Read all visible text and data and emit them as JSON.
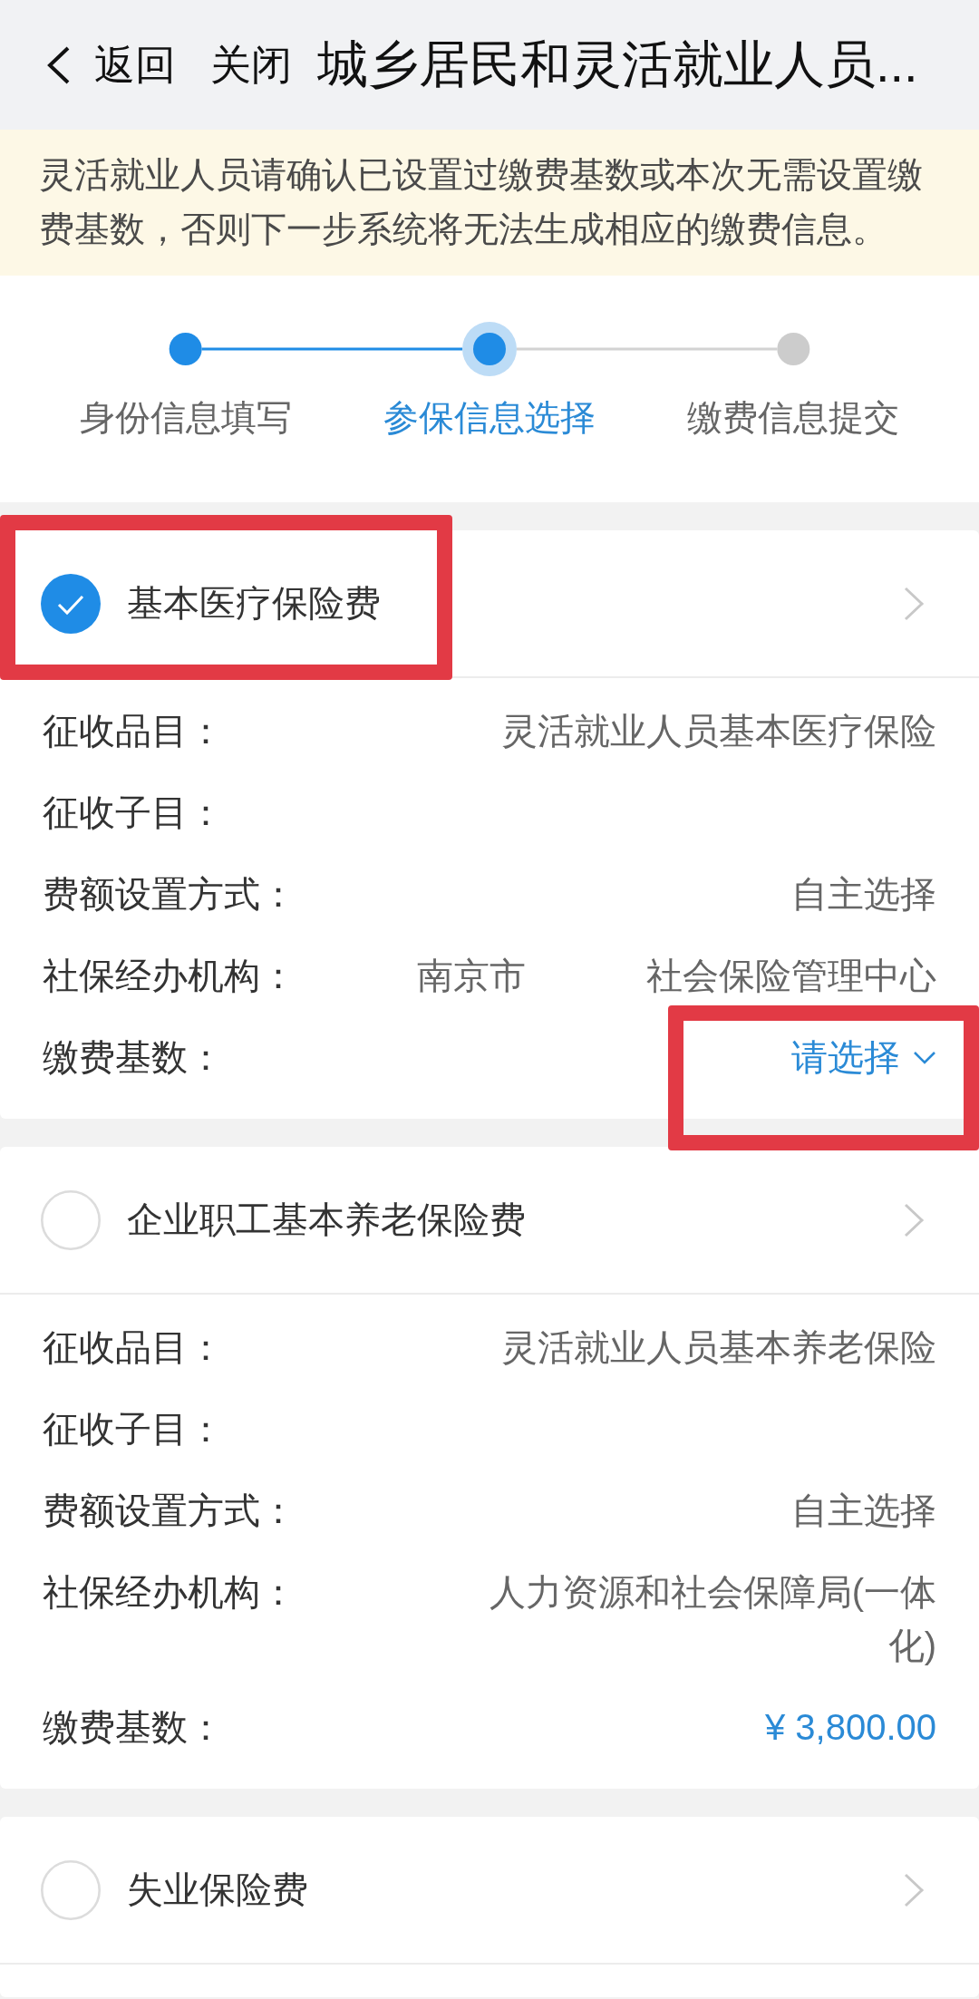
{
  "nav": {
    "back": "返回",
    "close": "关闭",
    "title": "城乡居民和灵活就业人员..."
  },
  "notice": "灵活就业人员请确认已设置过缴费基数或本次无需设置缴费基数，否则下一步系统将无法生成相应的缴费信息。",
  "steps": [
    {
      "label": "身份信息填写",
      "completed": true,
      "selected": false
    },
    {
      "label": "参保信息选择",
      "completed": false,
      "selected": true
    },
    {
      "label": "缴费信息提交",
      "completed": false,
      "selected": false
    }
  ],
  "items": [
    {
      "title": "基本医疗保险费",
      "checked": true,
      "highlighted": true,
      "fields": [
        {
          "kind": "text",
          "label": "征收品目：",
          "values": [
            "灵活就业人员基本医疗保险"
          ],
          "highlighted": false
        },
        {
          "kind": "text",
          "label": "征收子目：",
          "highlighted": false
        },
        {
          "kind": "text",
          "label": "费额设置方式：",
          "values": [
            "自主选择"
          ],
          "highlighted": false
        },
        {
          "kind": "text",
          "label": "社保经办机构：",
          "values": [
            "南京市",
            "社会保险管理中心"
          ],
          "highlighted": false
        },
        {
          "kind": "select",
          "label": "缴费基数：",
          "placeholder": "请选择",
          "highlighted": true
        }
      ]
    },
    {
      "title": "企业职工基本养老保险费",
      "checked": false,
      "highlighted": false,
      "fields": [
        {
          "kind": "text",
          "label": "征收品目：",
          "values": [
            "灵活就业人员基本养老保险"
          ],
          "highlighted": false
        },
        {
          "kind": "text",
          "label": "征收子目：",
          "highlighted": false
        },
        {
          "kind": "text",
          "label": "费额设置方式：",
          "values": [
            "自主选择"
          ],
          "highlighted": false
        },
        {
          "kind": "text",
          "label": "社保经办机构：",
          "values": [
            "人力资源和社会保障局(一体化)"
          ],
          "highlighted": false
        },
        {
          "kind": "amount",
          "label": "缴费基数：",
          "value": "¥ 3,800.00",
          "highlighted": false
        }
      ]
    },
    {
      "title": "失业保险费",
      "checked": false,
      "highlighted": false
    }
  ]
}
